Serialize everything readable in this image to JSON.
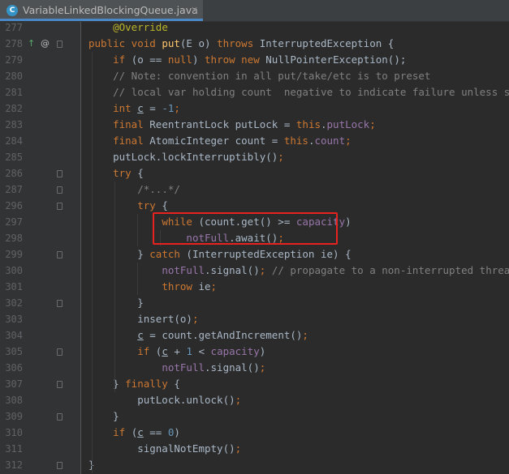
{
  "tab": {
    "icon": "java-class-icon",
    "icon_glyph": "C",
    "title": "VariableLinkedBlockingQueue.java",
    "close": "×"
  },
  "gutter_marks": {
    "override": "↑",
    "override_color": "#59a869",
    "annotation": "@"
  },
  "lines": [
    {
      "n": "277",
      "tokens": [
        {
          "t": "    ",
          "c": ""
        },
        {
          "t": "@Override",
          "c": "an"
        }
      ]
    },
    {
      "n": "278",
      "tokens": [
        {
          "t": "public void ",
          "c": "kw"
        },
        {
          "t": "put",
          "c": "mth"
        },
        {
          "t": "(",
          "c": ""
        },
        {
          "t": "E",
          "c": ""
        },
        {
          "t": " o) ",
          "c": ""
        },
        {
          "t": "throws ",
          "c": "kw"
        },
        {
          "t": "InterruptedException {",
          "c": ""
        }
      ]
    },
    {
      "n": "279",
      "tokens": [
        {
          "t": "    ",
          "c": ""
        },
        {
          "t": "if ",
          "c": "kw"
        },
        {
          "t": "(o == ",
          "c": ""
        },
        {
          "t": "null",
          "c": "kw"
        },
        {
          "t": ") ",
          "c": ""
        },
        {
          "t": "throw new ",
          "c": "kw"
        },
        {
          "t": "NullPointerException();",
          "c": ""
        }
      ]
    },
    {
      "n": "280",
      "tokens": [
        {
          "t": "    ",
          "c": ""
        },
        {
          "t": "// Note: convention in all put/take/etc is to preset",
          "c": "cm"
        }
      ]
    },
    {
      "n": "281",
      "tokens": [
        {
          "t": "    ",
          "c": ""
        },
        {
          "t": "// local var holding count  negative to indicate failure unless set.",
          "c": "cm"
        }
      ]
    },
    {
      "n": "282",
      "tokens": [
        {
          "t": "    ",
          "c": ""
        },
        {
          "t": "int ",
          "c": "kw"
        },
        {
          "t": "c",
          "c": "ul"
        },
        {
          "t": " = ",
          "c": ""
        },
        {
          "t": "-1",
          "c": "num"
        },
        {
          "t": ";",
          "c": "kw"
        }
      ]
    },
    {
      "n": "283",
      "tokens": [
        {
          "t": "    ",
          "c": ""
        },
        {
          "t": "final ",
          "c": "kw"
        },
        {
          "t": "ReentrantLock putLock = ",
          "c": ""
        },
        {
          "t": "this",
          "c": "kw"
        },
        {
          "t": ".",
          "c": ""
        },
        {
          "t": "putLock",
          "c": "fd"
        },
        {
          "t": ";",
          "c": "kw"
        }
      ]
    },
    {
      "n": "284",
      "tokens": [
        {
          "t": "    ",
          "c": ""
        },
        {
          "t": "final ",
          "c": "kw"
        },
        {
          "t": "AtomicInteger count = ",
          "c": ""
        },
        {
          "t": "this",
          "c": "kw"
        },
        {
          "t": ".",
          "c": ""
        },
        {
          "t": "count",
          "c": "fd"
        },
        {
          "t": ";",
          "c": "kw"
        }
      ]
    },
    {
      "n": "285",
      "tokens": [
        {
          "t": "    putLock.lockInterruptibly()",
          "c": ""
        },
        {
          "t": ";",
          "c": "kw"
        }
      ]
    },
    {
      "n": "286",
      "tokens": [
        {
          "t": "    ",
          "c": ""
        },
        {
          "t": "try ",
          "c": "kw"
        },
        {
          "t": "{",
          "c": ""
        }
      ]
    },
    {
      "n": "287",
      "tokens": [
        {
          "t": "        ",
          "c": ""
        },
        {
          "t": "/*...*/",
          "c": "cm"
        }
      ]
    },
    {
      "n": "296",
      "tokens": [
        {
          "t": "        ",
          "c": ""
        },
        {
          "t": "try ",
          "c": "kw"
        },
        {
          "t": "{",
          "c": ""
        }
      ]
    },
    {
      "n": "297",
      "tokens": [
        {
          "t": "            ",
          "c": ""
        },
        {
          "t": "while ",
          "c": "kw"
        },
        {
          "t": "(count.get() >= ",
          "c": ""
        },
        {
          "t": "capacity",
          "c": "fd"
        },
        {
          "t": ")",
          "c": ""
        }
      ]
    },
    {
      "n": "298",
      "tokens": [
        {
          "t": "                ",
          "c": ""
        },
        {
          "t": "notFull",
          "c": "fd"
        },
        {
          "t": ".await()",
          "c": ""
        },
        {
          "t": ";",
          "c": "kw"
        }
      ]
    },
    {
      "n": "299",
      "tokens": [
        {
          "t": "        } ",
          "c": ""
        },
        {
          "t": "catch ",
          "c": "kw"
        },
        {
          "t": "(InterruptedException ie) {",
          "c": ""
        }
      ]
    },
    {
      "n": "300",
      "tokens": [
        {
          "t": "            ",
          "c": ""
        },
        {
          "t": "notFull",
          "c": "fd"
        },
        {
          "t": ".signal()",
          "c": ""
        },
        {
          "t": "; ",
          "c": "kw"
        },
        {
          "t": "// propagate to a non-interrupted thread",
          "c": "cm"
        }
      ]
    },
    {
      "n": "301",
      "tokens": [
        {
          "t": "            ",
          "c": ""
        },
        {
          "t": "throw ",
          "c": "kw"
        },
        {
          "t": "ie",
          "c": ""
        },
        {
          "t": ";",
          "c": "kw"
        }
      ]
    },
    {
      "n": "302",
      "tokens": [
        {
          "t": "        }",
          "c": ""
        }
      ]
    },
    {
      "n": "303",
      "tokens": [
        {
          "t": "        insert(o)",
          "c": ""
        },
        {
          "t": ";",
          "c": "kw"
        }
      ]
    },
    {
      "n": "304",
      "tokens": [
        {
          "t": "        ",
          "c": ""
        },
        {
          "t": "c",
          "c": "ul"
        },
        {
          "t": " = count.getAndIncrement()",
          "c": ""
        },
        {
          "t": ";",
          "c": "kw"
        }
      ]
    },
    {
      "n": "305",
      "tokens": [
        {
          "t": "        ",
          "c": ""
        },
        {
          "t": "if ",
          "c": "kw"
        },
        {
          "t": "(",
          "c": ""
        },
        {
          "t": "c",
          "c": "ul"
        },
        {
          "t": " + ",
          "c": ""
        },
        {
          "t": "1",
          "c": "num"
        },
        {
          "t": " < ",
          "c": ""
        },
        {
          "t": "capacity",
          "c": "fd"
        },
        {
          "t": ")",
          "c": ""
        }
      ]
    },
    {
      "n": "306",
      "tokens": [
        {
          "t": "            ",
          "c": ""
        },
        {
          "t": "notFull",
          "c": "fd"
        },
        {
          "t": ".signal()",
          "c": ""
        },
        {
          "t": ";",
          "c": "kw"
        }
      ]
    },
    {
      "n": "307",
      "tokens": [
        {
          "t": "    } ",
          "c": ""
        },
        {
          "t": "finally ",
          "c": "kw"
        },
        {
          "t": "{",
          "c": ""
        }
      ]
    },
    {
      "n": "308",
      "tokens": [
        {
          "t": "        putLock.unlock()",
          "c": ""
        },
        {
          "t": ";",
          "c": "kw"
        }
      ]
    },
    {
      "n": "309",
      "tokens": [
        {
          "t": "    }",
          "c": ""
        }
      ]
    },
    {
      "n": "310",
      "tokens": [
        {
          "t": "    ",
          "c": ""
        },
        {
          "t": "if ",
          "c": "kw"
        },
        {
          "t": "(",
          "c": ""
        },
        {
          "t": "c",
          "c": "ul"
        },
        {
          "t": " == ",
          "c": ""
        },
        {
          "t": "0",
          "c": "num"
        },
        {
          "t": ")",
          "c": ""
        }
      ]
    },
    {
      "n": "311",
      "tokens": [
        {
          "t": "        signalNotEmpty()",
          "c": ""
        },
        {
          "t": ";",
          "c": "kw"
        }
      ]
    },
    {
      "n": "312",
      "tokens": [
        {
          "t": "}",
          "c": ""
        }
      ]
    }
  ]
}
